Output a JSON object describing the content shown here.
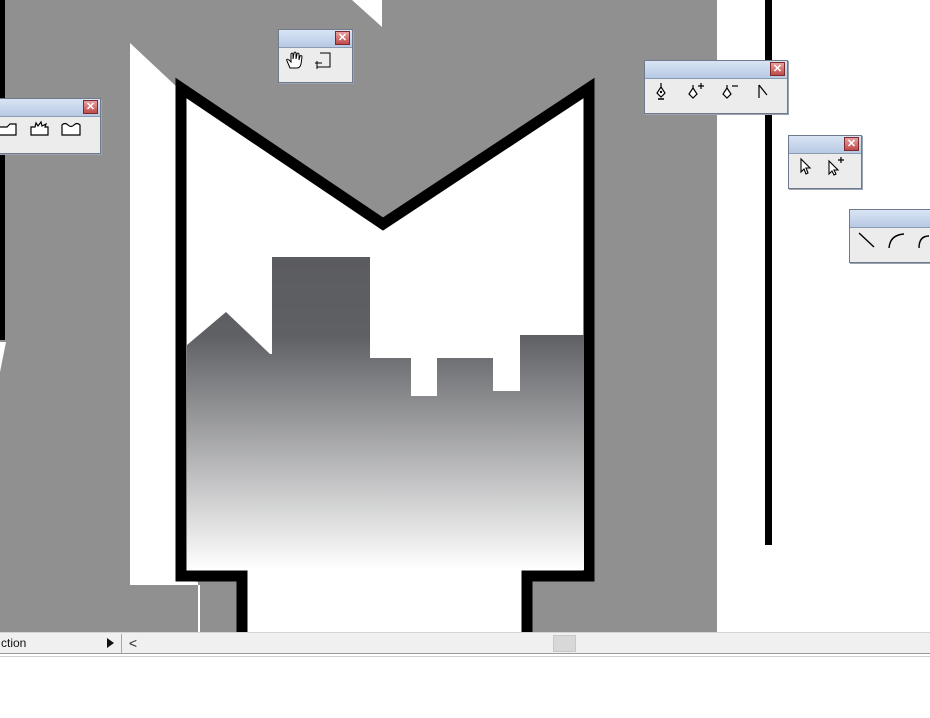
{
  "colors": {
    "gray_bg": "#909090",
    "black_outline": "#000000",
    "building_dark": "#5b5c60",
    "palette_title": "#c8d7ec",
    "close_red": "#c04a4a"
  },
  "palettes": [
    {
      "name": "shape-palette",
      "tools": [
        "rectangle-shape-icon",
        "rounded-burst-shape-icon",
        "wavy-rect-shape-icon"
      ]
    },
    {
      "name": "navigation-palette",
      "tools": [
        "hand-tool-icon",
        "page-tool-icon"
      ]
    },
    {
      "name": "pen-palette",
      "tools": [
        "pen-tool-icon",
        "add-anchor-icon",
        "delete-anchor-icon",
        "convert-anchor-icon"
      ]
    },
    {
      "name": "selection-palette",
      "tools": [
        "selection-arrow-icon",
        "subselect-add-icon"
      ]
    },
    {
      "name": "line-palette",
      "tools": [
        "line-tool-icon",
        "arc-tool-icon"
      ]
    }
  ],
  "close_glyph": "✕",
  "statusbar": {
    "field_text": "ction",
    "scroll_left_glyph": "<"
  }
}
